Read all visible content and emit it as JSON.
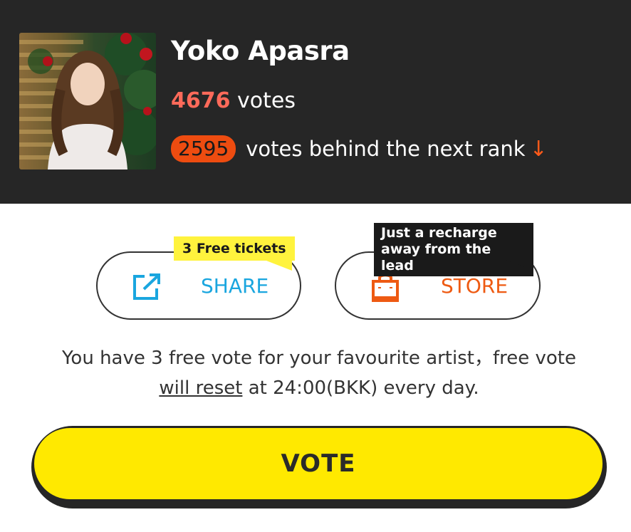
{
  "artist": {
    "name": "Yoko Apasra",
    "vote_count": "4676",
    "votes_label": "votes",
    "gap_count": "2595",
    "gap_label": "votes behind the next rank",
    "gap_arrow": "↓"
  },
  "actions": {
    "share": {
      "label": "SHARE",
      "icon": "share-icon",
      "tag": "3 Free tickets",
      "color": "#1aa6df"
    },
    "store": {
      "label": "STORE",
      "icon": "shopping-bag-icon",
      "tag_line1": "Just a recharge",
      "tag_line2": "away from the lead",
      "color": "#ee5a12"
    }
  },
  "info": {
    "text_part1": "You have 3 free vote for your favourite artist，free vote",
    "link_text": "will reset",
    "text_part2": " at 24:00(BKK) every day."
  },
  "vote_button": {
    "label": "VOTE",
    "color": "#ffe900"
  },
  "theme": {
    "header_bg": "#262626",
    "accent_red": "#ff6a5a",
    "badge_orange": "#ee4c10"
  }
}
